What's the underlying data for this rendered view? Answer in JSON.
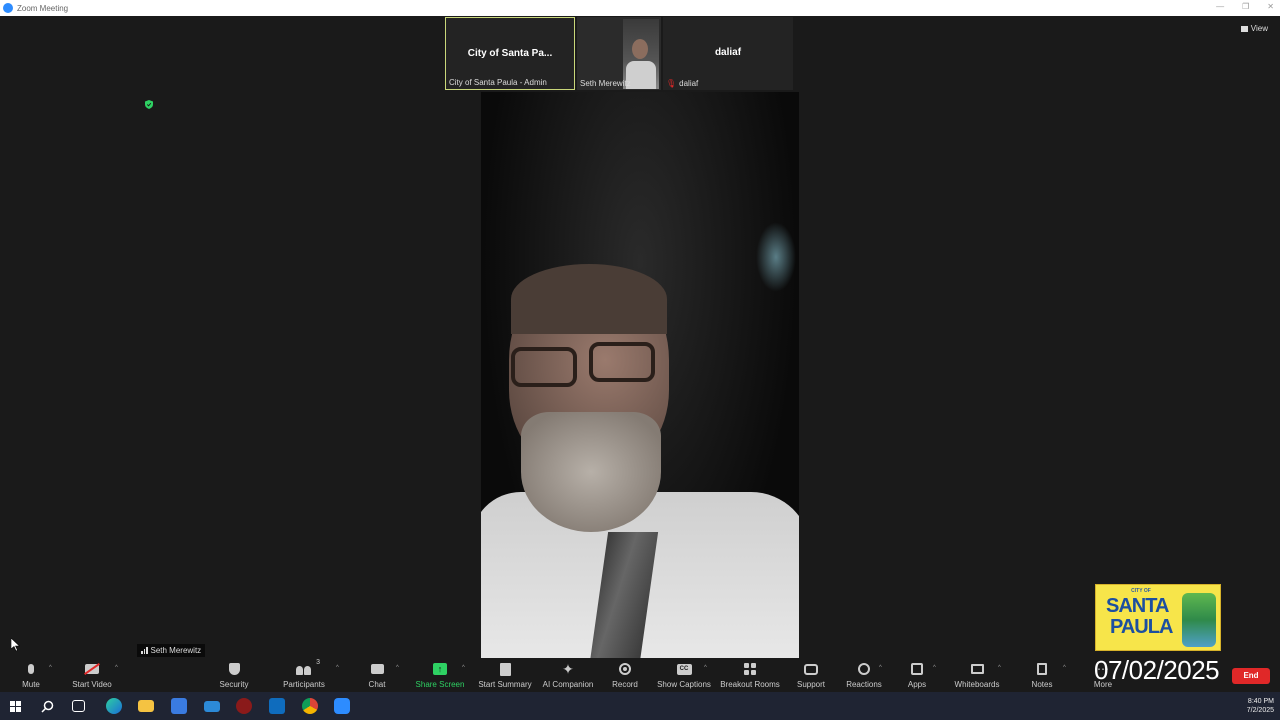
{
  "window": {
    "title": "Zoom Meeting"
  },
  "view_button": {
    "label": "View"
  },
  "thumbnails": [
    {
      "display_name": "City of Santa Pa...",
      "label": "City of Santa Paula - Admin"
    },
    {
      "label": "Seth Merewitz"
    },
    {
      "display_name": "daliaf",
      "label": "daliaf"
    }
  ],
  "speaker": {
    "name": "Seth Merewitz"
  },
  "overlay": {
    "date": "07/02/2025",
    "logo_small": "CITY OF",
    "logo_line1": "SANTA",
    "logo_line2": "PAULA"
  },
  "toolbar": {
    "mute": "Mute",
    "start_video": "Start Video",
    "security": "Security",
    "participants": "Participants",
    "participants_count": "3",
    "chat": "Chat",
    "share_screen": "Share Screen",
    "start_summary": "Start Summary",
    "ai_companion": "AI Companion",
    "record": "Record",
    "show_captions": "Show Captions",
    "breakout_rooms": "Breakout Rooms",
    "support": "Support",
    "reactions": "Reactions",
    "apps": "Apps",
    "whiteboards": "Whiteboards",
    "notes": "Notes",
    "more": "More",
    "end": "End",
    "cc_glyph": "CC"
  },
  "taskbar": {
    "time": "8:40 PM",
    "date": "7/2/2025"
  },
  "colors": {
    "accent_green": "#2ed163",
    "end_red": "#e02828",
    "active_border": "#c9d77a"
  }
}
